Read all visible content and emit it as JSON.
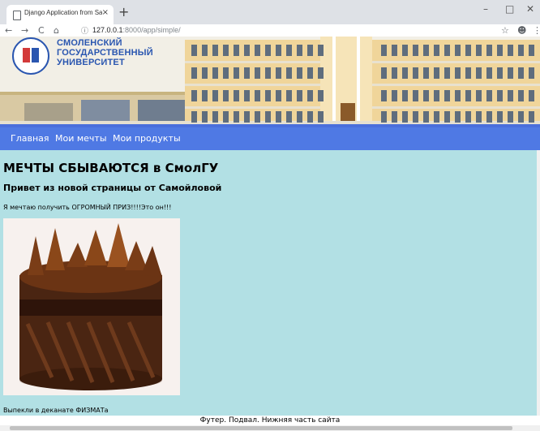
{
  "browser": {
    "tab_title": "Django Application from Samoil",
    "tab_close": "×",
    "new_tab": "+",
    "min": "–",
    "max": "□",
    "close": "✕",
    "back": "←",
    "forward": "→",
    "reload": "C",
    "home": "⌂",
    "info": "ⓘ",
    "url_host": "127.0.0.1",
    "url_rest": ":8000/app/simple/",
    "star": "☆",
    "account": "☻",
    "menu": "⋮"
  },
  "header": {
    "logo_line1": "СМОЛЕНСКИЙ",
    "logo_line2": "ГОСУДАРСТВЕННЫЙ",
    "logo_line3": "УНИВЕРСИТЕТ"
  },
  "nav": {
    "items": [
      {
        "label": "Главная"
      },
      {
        "label": "Мои мечты"
      },
      {
        "label": "Мои продукты"
      }
    ]
  },
  "content": {
    "heading": "МЕЧТЫ СБЫВАЮТСЯ в СмолГУ",
    "subheading": "Привет из новой страницы от Самойловой",
    "paragraph": "Я мечтаю получить ОГРОМНЫЙ ПРИЗ!!!!Это он!!!",
    "image_subject": "chocolate-cake",
    "caption": "Выпекли в деканате ФИЗМАТа"
  },
  "footer": {
    "text": "Футер. Подвал. Нижняя часть сайта"
  },
  "colors": {
    "navbar": "#4f79e4",
    "content_bg": "#b2e0e4"
  }
}
